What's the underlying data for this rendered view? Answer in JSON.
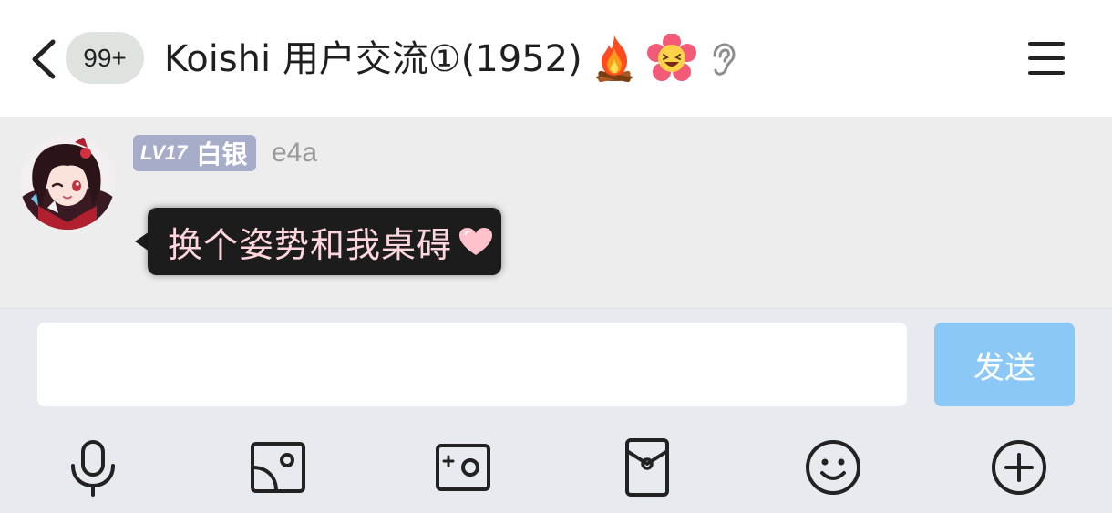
{
  "header": {
    "back_icon": "back-chevron-icon",
    "unread_badge": "99+",
    "title": "Koishi 用户交流①(1952)",
    "status_icons": [
      "fire-icon",
      "laughing-flower-icon",
      "ear-icon"
    ],
    "menu_icon": "hamburger-menu-icon"
  },
  "message": {
    "level": "LV17",
    "level_title": "白银",
    "level_badge_color": "#a7acc9",
    "username": "e4a",
    "text": "换个姿势和我桌碍",
    "bubble_color": "#1c1c1c",
    "text_color": "#ffd6dc",
    "trailing_icon": "pink-heart-icon"
  },
  "composer": {
    "input_value": "",
    "send_label": "发送",
    "send_color": "#8cc8f5"
  },
  "toolbar": {
    "icons": [
      "microphone-icon",
      "image-icon",
      "camera-icon",
      "red-packet-icon",
      "emoji-icon",
      "plus-icon"
    ]
  }
}
